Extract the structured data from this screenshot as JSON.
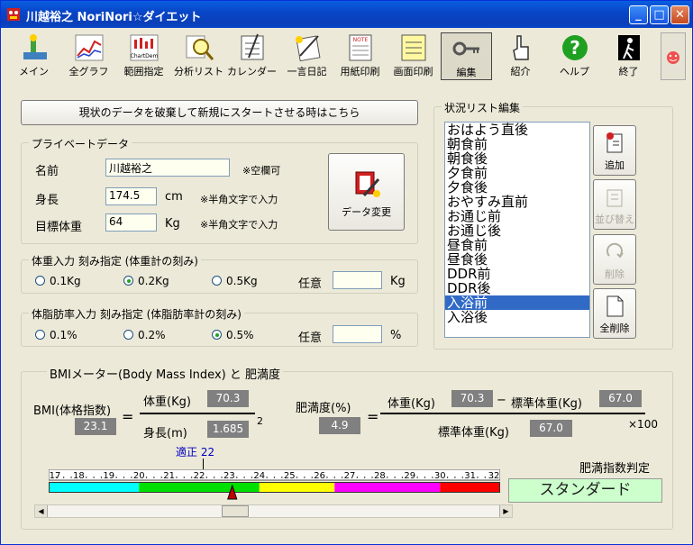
{
  "window": {
    "title": "川越裕之 NoriNori☆ダイエット"
  },
  "toolbar": {
    "items": [
      "メイン",
      "全グラフ",
      "範囲指定",
      "分析リスト",
      "カレンダー",
      "一言日記",
      "用紙印刷",
      "画面印刷",
      "編集",
      "紹介",
      "ヘルプ",
      "終了"
    ],
    "chart_icon_text": "ChartDem",
    "note_icon_text": "NOTE"
  },
  "reset_button": "現状のデータを破棄して新規にスタートさせる時はこちら",
  "private": {
    "caption": "プライベートデータ",
    "name_label": "名前",
    "name_value": "川越裕之",
    "name_note": "※空欄可",
    "height_label": "身長",
    "height_value": "174.5",
    "height_unit": "cm",
    "height_note": "※半角文字で入力",
    "target_label": "目標体重",
    "target_value": "64",
    "target_unit": "Kg",
    "target_note": "※半角文字で入力",
    "change_button": "データ変更"
  },
  "weight_step": {
    "caption": "体重入力 刻み指定 (体重計の刻み)",
    "options": [
      "0.1Kg",
      "0.2Kg",
      "0.5Kg"
    ],
    "selected": 1,
    "custom_label": "任意",
    "custom_unit": "Kg",
    "custom_value": ""
  },
  "fat_step": {
    "caption": "体脂肪率入力 刻み指定 (体脂肪率計の刻み)",
    "options": [
      "0.1%",
      "0.2%",
      "0.5%"
    ],
    "selected": 2,
    "custom_label": "任意",
    "custom_unit": "%",
    "custom_value": ""
  },
  "status_list": {
    "caption": "状況リスト編集",
    "items": [
      "おはよう直後",
      "朝食前",
      "朝食後",
      "夕食前",
      "夕食後",
      "おやすみ直前",
      "お通じ前",
      "お通じ後",
      "昼食前",
      "昼食後",
      "DDR前",
      "DDR後",
      "入浴前",
      "入浴後"
    ],
    "selected_index": 12,
    "buttons": {
      "add": "追加",
      "sort": "並び替え",
      "delete": "削除",
      "delete_all": "全削除"
    }
  },
  "bmi": {
    "caption": "BMIメーター(Body Mass Index) と 肥満度",
    "bmi_label": "BMI(体格指数)",
    "bmi_value": "23.1",
    "weight_label": "体重(Kg)",
    "weight_value": "70.3",
    "height_label": "身長(m)",
    "height_value": "1.685",
    "exponent": "2",
    "obesity_label": "肥満度(%)",
    "obesity_value": "4.9",
    "std_weight_label": "標準体重(Kg)",
    "std_weight_value": "67.0",
    "minus": "−",
    "times": "×100",
    "equals": "=",
    "ideal_label": "適正 22",
    "scale_ticks": [
      "17",
      "18",
      "19",
      "20",
      "21",
      "22",
      "23",
      "24",
      "25",
      "26",
      "27",
      "28",
      "29",
      "30",
      "31",
      "32"
    ],
    "judgement_label": "肥満指数判定",
    "judgement_value": "スタンダード",
    "pointer_value": 23.1,
    "bands": [
      {
        "from": 17,
        "to": 20,
        "color": "#00ffff"
      },
      {
        "from": 20,
        "to": 24,
        "color": "#00e000"
      },
      {
        "from": 24,
        "to": 26.5,
        "color": "#ffff00"
      },
      {
        "from": 26.5,
        "to": 30,
        "color": "#ff00ff"
      },
      {
        "from": 30,
        "to": 32,
        "color": "#ff0000"
      }
    ]
  }
}
